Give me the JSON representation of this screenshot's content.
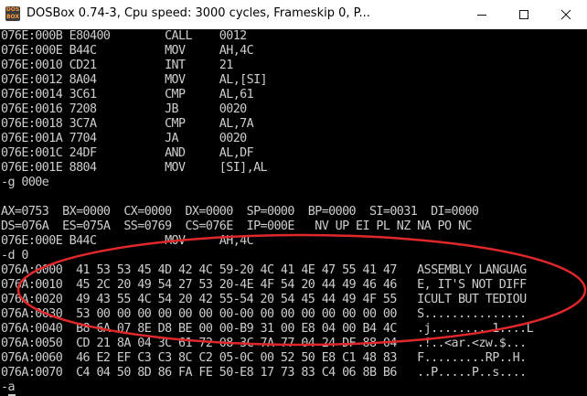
{
  "window": {
    "title": "DOSBox 0.74-3, Cpu speed:     3000 cycles, Frameskip  0, P...",
    "icon_text_top": "DOS",
    "icon_text_bottom": "BOX",
    "minimize_icon": "minimize-icon",
    "maximize_icon": "maximize-icon",
    "close_icon": "close-icon"
  },
  "console": {
    "lines": [
      "076E:000B E80400        CALL    0012",
      "076E:000E B44C          MOV     AH,4C",
      "076E:0010 CD21          INT     21",
      "076E:0012 8A04          MOV     AL,[SI]",
      "076E:0014 3C61          CMP     AL,61",
      "076E:0016 7208          JB      0020",
      "076E:0018 3C7A          CMP     AL,7A",
      "076E:001A 7704          JA      0020",
      "076E:001C 24DF          AND     AL,DF",
      "076E:001E 8804          MOV     [SI],AL",
      "-g 000e",
      "",
      "AX=0753  BX=0000  CX=0000  DX=0000  SP=0000  BP=0000  SI=0031  DI=0000",
      "DS=076A  ES=075A  SS=0769  CS=076E  IP=000E   NV UP EI PL NZ NA PO NC",
      "076E:000E B44C          MOV     AH,4C",
      "-d 0",
      "076A:0000  41 53 53 45 4D 42 4C 59-20 4C 41 4E 47 55 41 47   ASSEMBLY LANGUAG",
      "076A:0010  45 2C 20 49 54 27 53 20-4E 4F 54 20 44 49 46 46   E, IT'S NOT DIFF",
      "076A:0020  49 43 55 4C 54 20 42 55-54 20 54 45 44 49 4F 55   ICULT BUT TEDIOU",
      "076A:0030  53 00 00 00 00 00 00 00-00 00 00 00 00 00 00 00   S...............",
      "076A:0040  B8 6A 07 8E D8 BE 00 00-B9 31 00 E8 04 00 B4 4C   .j.........1....L",
      "076A:0050  CD 21 8A 04 3C 61 72 08-3C 7A 77 04 24 DF 88 04   .!..<ar.<zw.$...",
      "076A:0060  46 E2 EF C3 C3 8C C2 05-0C 00 52 50 E8 C1 48 83   F.........RP..H.",
      "076A:0070  C4 04 50 8D 86 FA FE 50-E8 17 73 83 C4 06 8B B6   ..P.....P..s....",
      "-a"
    ]
  },
  "colors": {
    "console_bg": "#000000",
    "console_text": "#cdcdcd",
    "annotation_ellipse": "#e0282a"
  }
}
